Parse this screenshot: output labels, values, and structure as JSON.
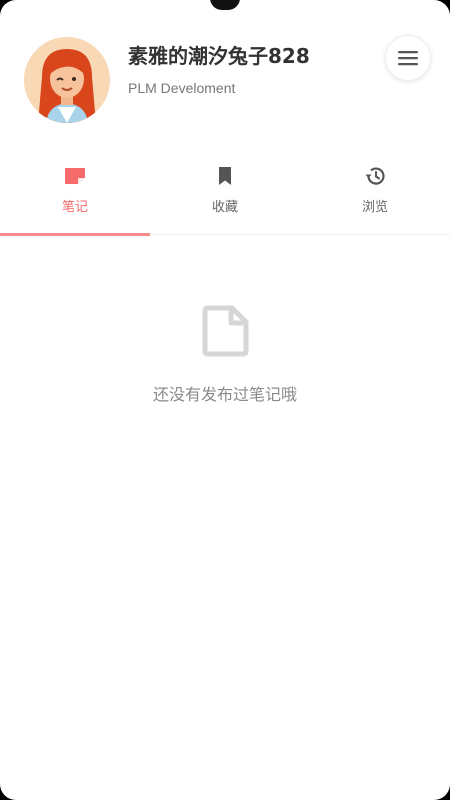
{
  "profile": {
    "username": "素雅的潮汐兔子828",
    "subtitle": "PLM Develoment",
    "avatar_icon": "avatar-girl-icon",
    "menu_icon": "hamburger-menu-icon"
  },
  "tabs": [
    {
      "label": "笔记",
      "icon": "note-icon",
      "active": true
    },
    {
      "label": "收藏",
      "icon": "bookmark-icon",
      "active": false
    },
    {
      "label": "浏览",
      "icon": "history-icon",
      "active": false
    }
  ],
  "empty_state": {
    "icon": "document-icon",
    "text": "还没有发布过笔记哦"
  },
  "colors": {
    "accent": "#f56b6b",
    "indicator": "#f78a8a",
    "icon_gray": "#555555",
    "empty_icon": "#d6d6d6"
  }
}
